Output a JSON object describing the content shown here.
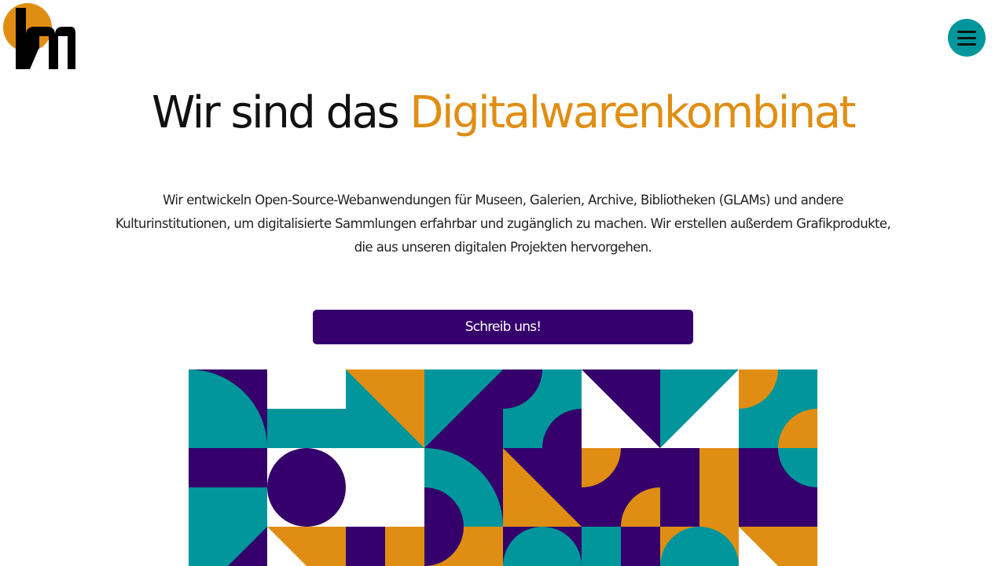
{
  "header": {
    "menu_icon": "hamburger-icon",
    "colors": {
      "accent": "#e08e13",
      "teal": "#00969b",
      "purple": "#35006b"
    }
  },
  "hero": {
    "headline_prefix": "Wir sind das ",
    "headline_accent": "Digitalwarenkombinat",
    "intro_text": "Wir entwickeln Open-Source-Webanwendungen für Museen, Galerien, Archive, Bibliotheken (GLAMs) und andere Kulturinstitutionen, um digitalisierte Sammlungen erfahrbar und zugänglich zu machen. Wir erstellen außerdem Grafikprodukte, die aus unseren digitalen Projekten hervorgehen.",
    "cta_label": "Schreib uns!"
  }
}
